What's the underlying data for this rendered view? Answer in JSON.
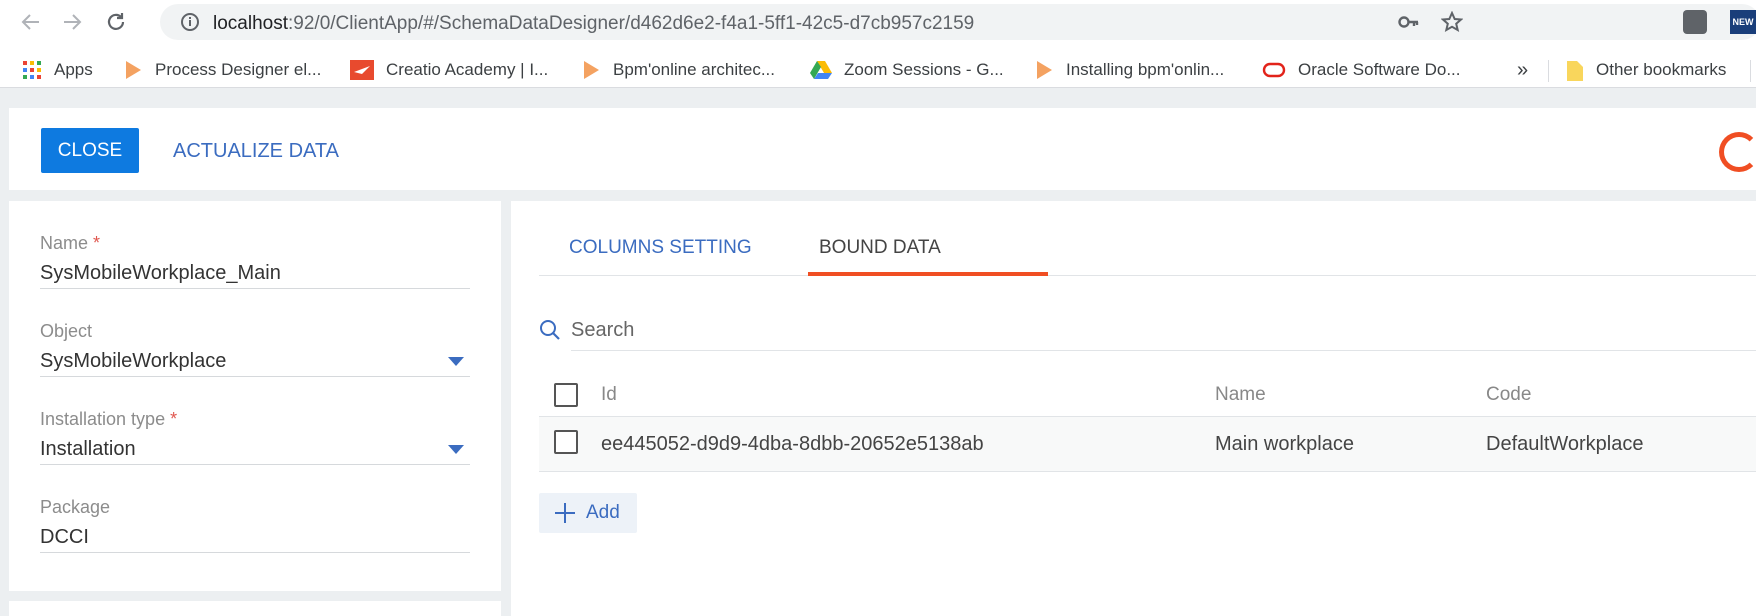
{
  "browser": {
    "url_host": "localhost",
    "url_path": ":92/0/ClientApp/#/SchemaDataDesigner/d462d6e2-f4a1-5ff1-42c5-d7cb957c2159",
    "bookmarks": [
      {
        "label": "Apps",
        "icon": "apps-grid-icon"
      },
      {
        "label": "Process Designer el...",
        "icon": "play-triangle-icon"
      },
      {
        "label": "Creatio Academy | I...",
        "icon": "creatio-logo-icon"
      },
      {
        "label": "Bpm'online architec...",
        "icon": "play-triangle-icon"
      },
      {
        "label": "Zoom Sessions - G...",
        "icon": "google-drive-icon"
      },
      {
        "label": "Installing bpm'onlin...",
        "icon": "play-triangle-icon"
      },
      {
        "label": "Oracle Software Do...",
        "icon": "oracle-logo-icon"
      }
    ],
    "overflow_label": "»",
    "other_bookmarks": "Other bookmarks",
    "ext_badge": "NEW"
  },
  "header": {
    "close_label": "CLOSE",
    "actualize_label": "ACTUALIZE DATA"
  },
  "form": {
    "name_label": "Name",
    "name_value": "SysMobileWorkplace_Main",
    "object_label": "Object",
    "object_value": "SysMobileWorkplace",
    "install_label": "Installation type",
    "install_value": "Installation",
    "package_label": "Package",
    "package_value": "DCCI",
    "required_mark": "*"
  },
  "tabs": {
    "columns": "COLUMNS SETTING",
    "bound": "BOUND DATA"
  },
  "search": {
    "placeholder": "Search"
  },
  "grid": {
    "headers": {
      "id": "Id",
      "name": "Name",
      "code": "Code"
    },
    "rows": [
      {
        "id": "ee445052-d9d9-4dba-8dbb-20652e5138ab",
        "name": "Main workplace",
        "code": "DefaultWorkplace"
      }
    ]
  },
  "add_label": "Add",
  "colors": {
    "accent": "#0e7ae0",
    "tab_underline": "#f04e23",
    "link": "#3b6cc0"
  }
}
